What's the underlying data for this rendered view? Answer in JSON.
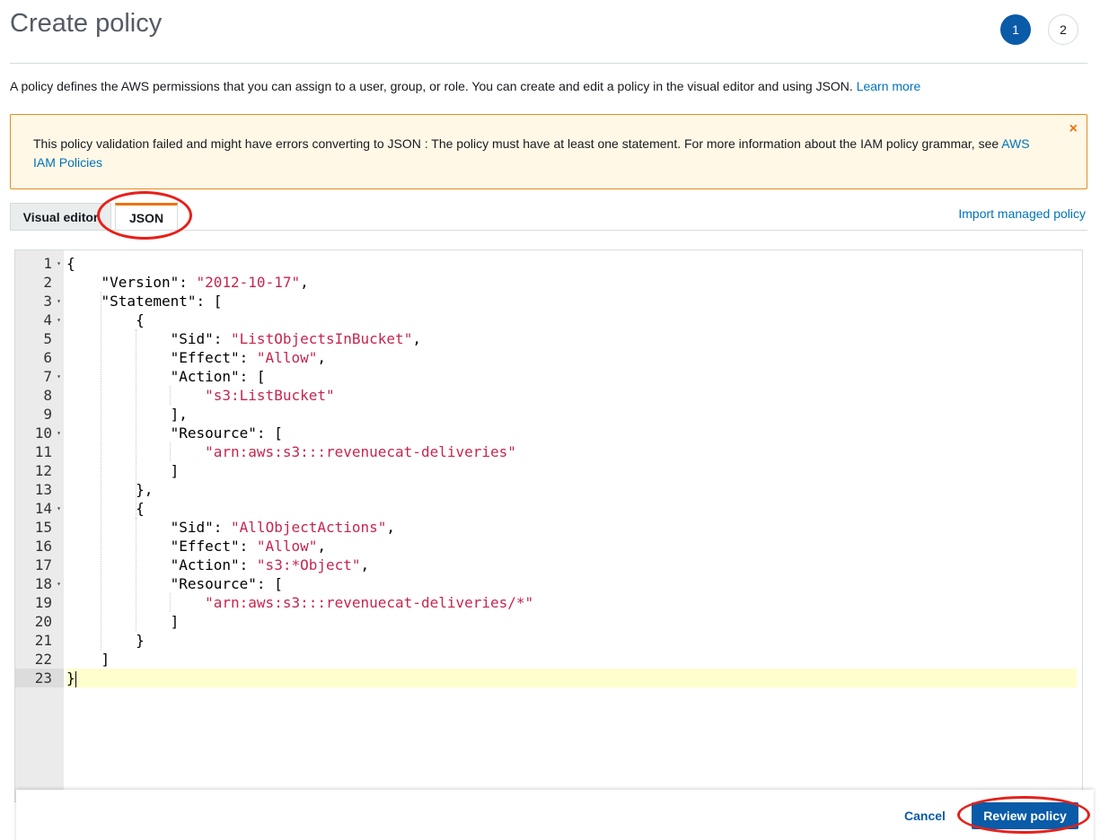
{
  "header": {
    "title": "Create policy",
    "steps": [
      "1",
      "2"
    ]
  },
  "intro": {
    "text": "A policy defines the AWS permissions that you can assign to a user, group, or role. You can create and edit a policy in the visual editor and using JSON. ",
    "link": "Learn more"
  },
  "alert": {
    "text": "This policy validation failed and might have errors converting to JSON : The policy must have at least one statement. For more information about the IAM policy grammar, see ",
    "link": "AWS IAM Policies",
    "close_icon": "×"
  },
  "tabs": [
    {
      "label": "Visual editor",
      "active": false
    },
    {
      "label": "JSON",
      "active": true
    }
  ],
  "import_link": "Import managed policy",
  "editor": {
    "line_numbers": [
      "1",
      "2",
      "3",
      "4",
      "5",
      "6",
      "7",
      "8",
      "9",
      "10",
      "11",
      "12",
      "13",
      "14",
      "15",
      "16",
      "17",
      "18",
      "19",
      "20",
      "21",
      "22",
      "23"
    ],
    "foldable_lines": [
      1,
      3,
      4,
      7,
      10,
      14,
      18
    ],
    "active_line": 23,
    "lines": [
      [
        {
          "t": "{"
        }
      ],
      [
        {
          "t": "    \"Version\": "
        },
        {
          "t": "\"2012-10-17\"",
          "s": 1
        },
        {
          "t": ","
        }
      ],
      [
        {
          "t": "    \"Statement\": ["
        }
      ],
      [
        {
          "t": "        {"
        }
      ],
      [
        {
          "t": "            \"Sid\": "
        },
        {
          "t": "\"ListObjectsInBucket\"",
          "s": 1
        },
        {
          "t": ","
        }
      ],
      [
        {
          "t": "            \"Effect\": "
        },
        {
          "t": "\"Allow\"",
          "s": 1
        },
        {
          "t": ","
        }
      ],
      [
        {
          "t": "            \"Action\": ["
        }
      ],
      [
        {
          "t": "                "
        },
        {
          "t": "\"s3:ListBucket\"",
          "s": 1
        }
      ],
      [
        {
          "t": "            ],"
        }
      ],
      [
        {
          "t": "            \"Resource\": ["
        }
      ],
      [
        {
          "t": "                "
        },
        {
          "t": "\"arn:aws:s3:::revenuecat-deliveries\"",
          "s": 1
        }
      ],
      [
        {
          "t": "            ]"
        }
      ],
      [
        {
          "t": "        },"
        }
      ],
      [
        {
          "t": "        {"
        }
      ],
      [
        {
          "t": "            \"Sid\": "
        },
        {
          "t": "\"AllObjectActions\"",
          "s": 1
        },
        {
          "t": ","
        }
      ],
      [
        {
          "t": "            \"Effect\": "
        },
        {
          "t": "\"Allow\"",
          "s": 1
        },
        {
          "t": ","
        }
      ],
      [
        {
          "t": "            \"Action\": "
        },
        {
          "t": "\"s3:*Object\"",
          "s": 1
        },
        {
          "t": ","
        }
      ],
      [
        {
          "t": "            \"Resource\": ["
        }
      ],
      [
        {
          "t": "                "
        },
        {
          "t": "\"arn:aws:s3:::revenuecat-deliveries/*\"",
          "s": 1
        }
      ],
      [
        {
          "t": "            ]"
        }
      ],
      [
        {
          "t": "        }"
        }
      ],
      [
        {
          "t": "    ]"
        }
      ],
      [
        {
          "t": "}"
        }
      ]
    ]
  },
  "footer": {
    "cancel_label": "Cancel",
    "review_label": "Review policy"
  },
  "colors": {
    "primary": "#0a5ba8",
    "link": "#0073bb",
    "alert_border": "#e28e1e",
    "alert_bg": "#fff8e6",
    "tab_accent": "#ec7211",
    "json_string": "#c7254e",
    "annotation_ring": "#e6201a"
  }
}
